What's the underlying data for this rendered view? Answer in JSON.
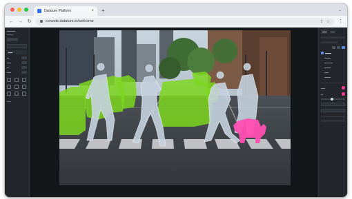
{
  "browser": {
    "tab_title": "Datature Platform",
    "tab_close": "×",
    "new_tab": "+",
    "url": "console.datature.io/welcome",
    "traffic_colors": [
      "#ff5f57",
      "#febc2e",
      "#28c840"
    ],
    "icons": [
      "back-icon",
      "forward-icon",
      "reload-icon",
      "lock-icon",
      "share-icon",
      "star-icon",
      "menu-icon"
    ]
  },
  "colors": {
    "mask_car": "#7bd61f",
    "mask_person": "#b8c6d8",
    "mask_dog": "#ff4fb2",
    "accent": "#5b8def",
    "panel_bg": "#23272c"
  },
  "scene": {
    "description_icon": "annotated-street-image",
    "mask_classes": [
      "car",
      "person",
      "dog"
    ]
  }
}
